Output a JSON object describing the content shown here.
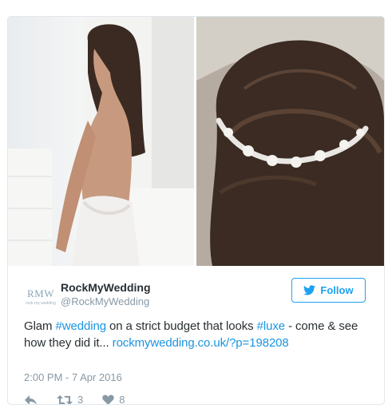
{
  "media": {
    "left_image_name": "bride-backless-dress-photo",
    "right_image_name": "hair-vine-accessory-photo"
  },
  "author": {
    "logo_text": "RMW",
    "logo_subtext": "rock my wedding",
    "display_name": "RockMyWedding",
    "handle": "@RockMyWedding"
  },
  "follow_button": {
    "label": "Follow",
    "icon": "twitter-bird-icon"
  },
  "tweet": {
    "text_1": "Glam ",
    "hashtag_1": "#wedding",
    "text_2": " on a strict budget that looks ",
    "hashtag_2": "#luxe",
    "text_3": " - come & see how they did it... ",
    "link": "rockmywedding.co.uk/?p=198208"
  },
  "timestamp": "2:00 PM - 7 Apr 2016",
  "actions": {
    "reply_icon": "reply-icon",
    "retweet_icon": "retweet-icon",
    "retweet_count": "3",
    "like_icon": "heart-icon",
    "like_count": "8"
  },
  "colors": {
    "accent": "#1da1f2",
    "link": "#1b95e0",
    "muted": "#8899a6",
    "text": "#292f33"
  }
}
